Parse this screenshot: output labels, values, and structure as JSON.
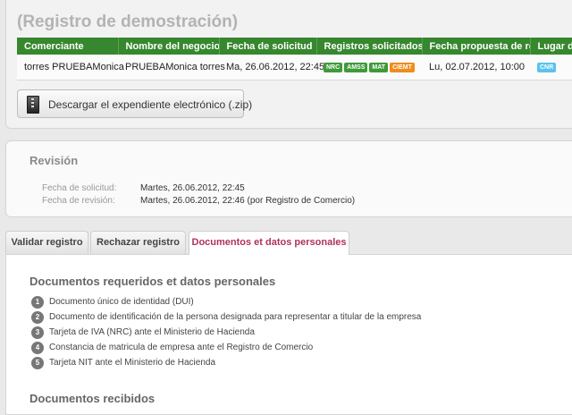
{
  "header": {
    "title": "(Registro de demostración)"
  },
  "table": {
    "columns": [
      "Comerciante",
      "Nombre del negocio",
      "Fecha de solicitud",
      "Registros solicitados",
      "Fecha propuesta de retiro",
      "Lugar de r"
    ],
    "row": {
      "comerciante": "torres PRUEBAMonica",
      "negocio": "PRUEBAMonica torres",
      "fecha_solicitud": "Ma, 26.06.2012, 22:45",
      "registros": [
        {
          "label": "NRC",
          "color": "#3f9a3a"
        },
        {
          "label": "AMSS",
          "color": "#3f9a3a"
        },
        {
          "label": "MAT",
          "color": "#3f9a3a"
        },
        {
          "label": "CIEMT",
          "color": "#ef8c1c"
        }
      ],
      "fecha_retiro": "Lu, 02.07.2012, 10:00",
      "lugar": {
        "label": "CNR",
        "color": "#5bc3ec"
      }
    }
  },
  "download_button": {
    "label": "Descargar el expendiente electrónico (.zip)",
    "icon": "zip-file-icon"
  },
  "review": {
    "title": "Revisión",
    "fields": [
      {
        "label": "Fecha de solicitud:",
        "value": "Martes, 26.06.2012, 22:45"
      },
      {
        "label": "Fecha de revisión:",
        "value": "Martes, 26.06.2012, 22:46 (por Registro de Comercio)"
      }
    ]
  },
  "tabs": [
    {
      "label": "Validar registro",
      "active": false
    },
    {
      "label": "Rechazar registro",
      "active": false
    },
    {
      "label": "Documentos et datos personales",
      "active": true
    }
  ],
  "documents": {
    "title": "Documentos requeridos et datos personales",
    "items": [
      {
        "num": "1",
        "text": "Documento único de identidad (DUI)"
      },
      {
        "num": "2",
        "text": "Documento de identificación de la persona designada para representar a titular de la empresa"
      },
      {
        "num": "3",
        "text": "Tarjeta de IVA (NRC) ante el Ministerio de Hacienda"
      },
      {
        "num": "4",
        "text": "Constancia de matricula de empresa ante el Registro de Comercio"
      },
      {
        "num": "5",
        "text": "Tarjeta NIT ante el Ministerio de Hacienda"
      }
    ],
    "received_title": "Documentos recibidos"
  },
  "colors": {
    "table_header": "#36872e",
    "active_tab": "#b03060",
    "title_gray": "#b3b3b3"
  }
}
